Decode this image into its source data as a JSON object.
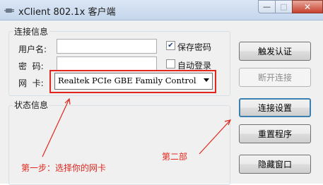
{
  "window": {
    "title": "xClient 802.1x 客户端",
    "controls": {
      "minimize": "—",
      "maximize": "□",
      "close": "✕"
    },
    "app_icon": "network-plug-icon"
  },
  "connection_group": {
    "title": "连接信息",
    "username_label": "用户名:",
    "username_value": "",
    "password_label": "密  码:",
    "password_value": "",
    "nic_label": "网  卡:",
    "nic_selected": "Realtek PCIe GBE Family Controlle",
    "save_password": {
      "label": "保存密码",
      "checked": true
    },
    "auto_login": {
      "label": "自动登录",
      "checked": false
    }
  },
  "status_group": {
    "title": "状态信息"
  },
  "buttons": {
    "trigger_auth": "触发认证",
    "disconnect": "断开连接",
    "connection_settings": "连接设置",
    "reset_program": "重置程序",
    "hide_window": "隐藏窗口"
  },
  "annotations": {
    "step_one": "第一步：选择你的网卡",
    "step_two": "第二部",
    "color": "#e2261d"
  }
}
